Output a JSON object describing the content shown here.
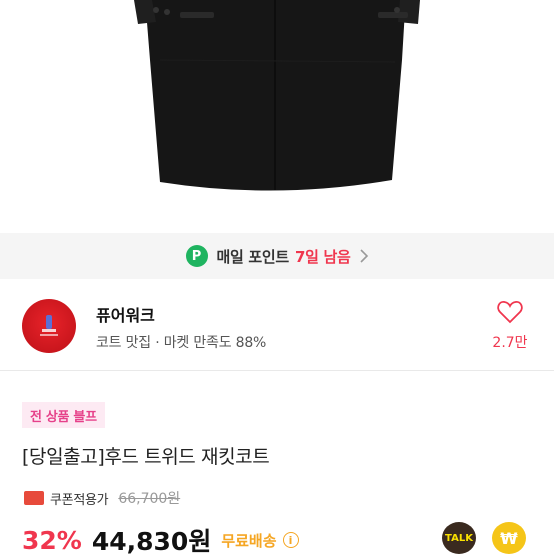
{
  "points_banner": {
    "badge": "P",
    "text": "매일 포인트",
    "days_left": "7일 남음"
  },
  "shop": {
    "name": "퓨어워크",
    "description": "코트 맛집 · 마켓 만족도 88%",
    "likes": "2.7만"
  },
  "product": {
    "promo_badge": "전 상품 블프",
    "title": "[당일출고]후드 트위드 재킷코트",
    "coupon_label": "쿠폰적용가",
    "original_price": "66,700원",
    "discount": "32%",
    "price": "44,830원",
    "shipping": "무료배송"
  },
  "actions": {
    "talk_label": "TALK",
    "pay_label": "₩"
  },
  "colors": {
    "accent": "#f0364e",
    "points_green": "#1fb460",
    "shipping": "#f5a623"
  }
}
